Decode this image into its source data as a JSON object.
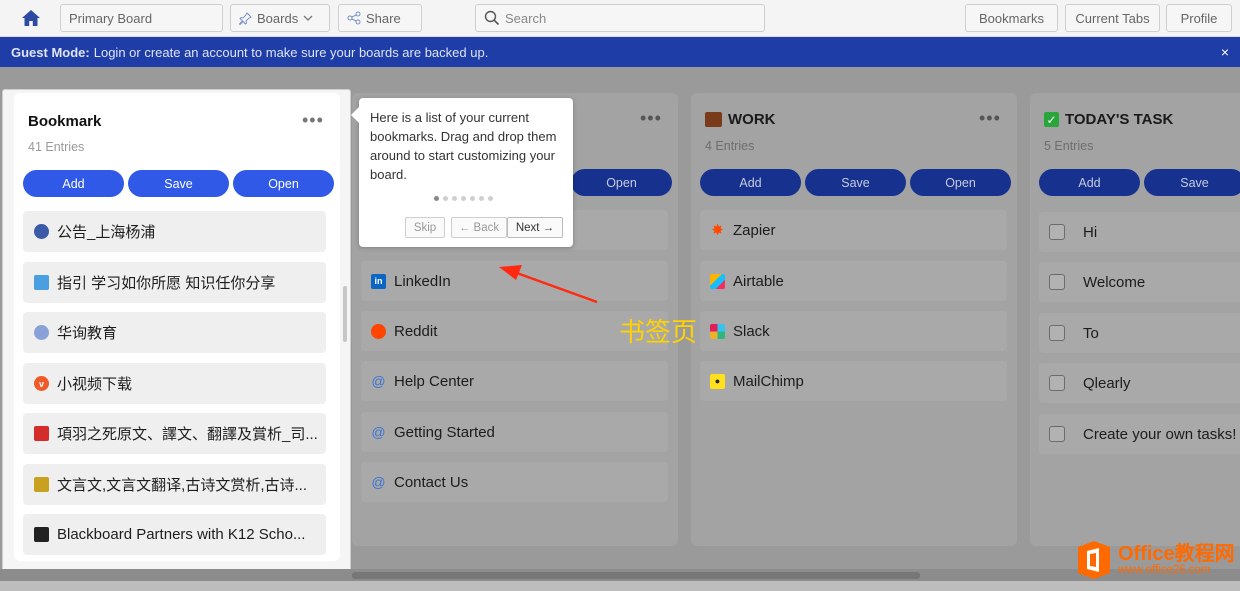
{
  "topbar": {
    "board_name": "Primary Board",
    "boards_label": "Boards",
    "share_label": "Share",
    "search_placeholder": "Search",
    "bookmarks_label": "Bookmarks",
    "current_tabs_label": "Current Tabs",
    "profile_label": "Profile"
  },
  "banner": {
    "prefix": "Guest Mode:",
    "message": "Login or create an account to make sure your boards are backed up.",
    "close": "×"
  },
  "bookmark_column": {
    "title": "Bookmark",
    "entries": "41 Entries",
    "add": "Add",
    "save": "Save",
    "open": "Open",
    "items": [
      {
        "label": "公告_上海杨浦"
      },
      {
        "label": "指引 学习如你所愿 知识任你分享"
      },
      {
        "label": "华询教育"
      },
      {
        "label": "小视频下载"
      },
      {
        "label": "項羽之死原文、譯文、翻譯及賞析_司..."
      },
      {
        "label": "文言文,文言文翻译,古诗文赏析,古诗..."
      },
      {
        "label": "Blackboard Partners with K12 Scho..."
      }
    ]
  },
  "second_column": {
    "open": "Open",
    "items": [
      {
        "label": "LinkedIn"
      },
      {
        "label": "Reddit"
      },
      {
        "label": "Help Center"
      },
      {
        "label": "Getting Started"
      },
      {
        "label": "Contact Us"
      }
    ]
  },
  "work_column": {
    "title": "WORK",
    "entries": "4 Entries",
    "add": "Add",
    "save": "Save",
    "open": "Open",
    "items": [
      {
        "label": "Zapier"
      },
      {
        "label": "Airtable"
      },
      {
        "label": "Slack"
      },
      {
        "label": "MailChimp"
      }
    ]
  },
  "task_column": {
    "title": "TODAY'S TASK",
    "entries": "5 Entries",
    "add": "Add",
    "save": "Save",
    "items": [
      {
        "label": "Hi"
      },
      {
        "label": "Welcome"
      },
      {
        "label": "To"
      },
      {
        "label": "Qlearly"
      },
      {
        "label": "Create your own tasks!"
      }
    ]
  },
  "tooltip": {
    "text": "Here is a list of your current bookmarks. Drag and drop them around to start customizing your board.",
    "skip": "Skip",
    "back": "← Back",
    "next": "Next →",
    "step": 1,
    "total_steps": 7
  },
  "annotation": "书签页",
  "watermark": {
    "name": "Office教程网",
    "url": "www.office26.com"
  },
  "colors": {
    "banner": "#1e3da6",
    "button": "#2f59e6",
    "annotation": "#ffd200",
    "arrow": "#ff2a10",
    "watermark": "#ff6a00"
  },
  "icons": {
    "home": "home-icon",
    "boards": "pin-icon",
    "share": "share-icon",
    "search": "search-icon"
  }
}
